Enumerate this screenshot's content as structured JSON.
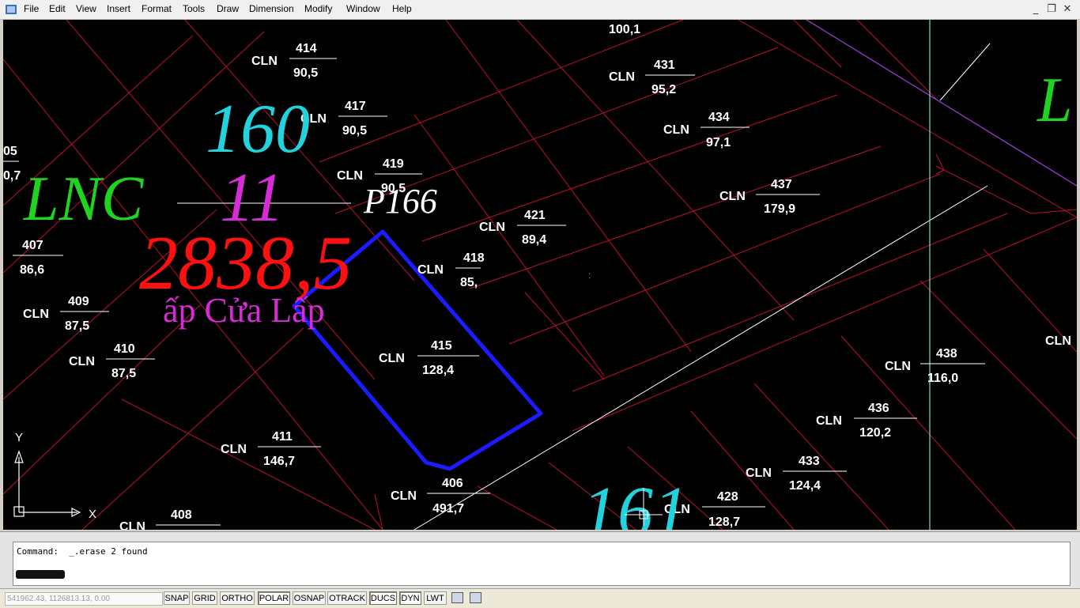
{
  "menu": {
    "items": [
      "File",
      "Edit",
      "View",
      "Insert",
      "Format",
      "Tools",
      "Draw",
      "Dimension",
      "Modify",
      "Window",
      "Help"
    ],
    "icons": {
      "minimize": "minimize-icon",
      "restore": "restore-icon",
      "close": "close-icon"
    }
  },
  "drawing": {
    "parcels": [
      {
        "type": "CLN",
        "num": "414",
        "area": "90,5"
      },
      {
        "type": "CLN",
        "num": "417",
        "area": "90,5"
      },
      {
        "type": "CLN",
        "num": "419",
        "area": "90,5"
      },
      {
        "type": "CLN",
        "num": "431",
        "area": "95,2"
      },
      {
        "type": "CLN",
        "num": "434",
        "area": "97,1"
      },
      {
        "type": "CLN",
        "num": "437",
        "area": "179,9"
      },
      {
        "type": "CLN",
        "num": "421",
        "area": "89,4"
      },
      {
        "type": "CLN",
        "num": "418",
        "area": "85,"
      },
      {
        "type": "CLN",
        "num": "415",
        "area": "128,4"
      },
      {
        "type": "",
        "num": "407",
        "area": "86,6"
      },
      {
        "type": "CLN",
        "num": "409",
        "area": "87,5"
      },
      {
        "type": "CLN",
        "num": "410",
        "area": "87,5"
      },
      {
        "type": "CLN",
        "num": "411",
        "area": "146,7"
      },
      {
        "type": "CLN",
        "num": "406",
        "area": "491,7"
      },
      {
        "type": "CLN",
        "num": "408",
        "area": ""
      },
      {
        "type": "CLN",
        "num": "438",
        "area": "116,0"
      },
      {
        "type": "CLN",
        "num": "436",
        "area": "120,2"
      },
      {
        "type": "CLN",
        "num": "433",
        "area": "124,4"
      },
      {
        "type": "CLN",
        "num": "428",
        "area": "128,7"
      }
    ],
    "partial": {
      "top_area": "100,1",
      "left_num": "05",
      "left_area": "0,7",
      "right_type": "CLN",
      "right_big": "L"
    },
    "big_labels": {
      "sheet_a": "160",
      "lot_a": "11",
      "land_type_a": "LNC",
      "total_area": "2838,5",
      "place": "ấp Cửa Lấp",
      "plot_ref": "P166",
      "sheet_b": "161"
    },
    "ucs": {
      "y": "Y",
      "x": "X"
    },
    "colors": {
      "boundary": "#c0102a",
      "selection": "#1b1bff",
      "green": "#1fd41f",
      "cyan": "#22d3dd",
      "magenta": "#d82bd8",
      "red": "#ff1010",
      "road": "#ffffff"
    }
  },
  "command": {
    "history": "Command:  _.erase 2 found"
  },
  "status": {
    "coords": "541962.43, 1126813.13, 0.00",
    "toggles": [
      "SNAP",
      "GRID",
      "ORTHO",
      "POLAR",
      "OSNAP",
      "OTRACK",
      "DUCS",
      "DYN",
      "LWT"
    ]
  }
}
